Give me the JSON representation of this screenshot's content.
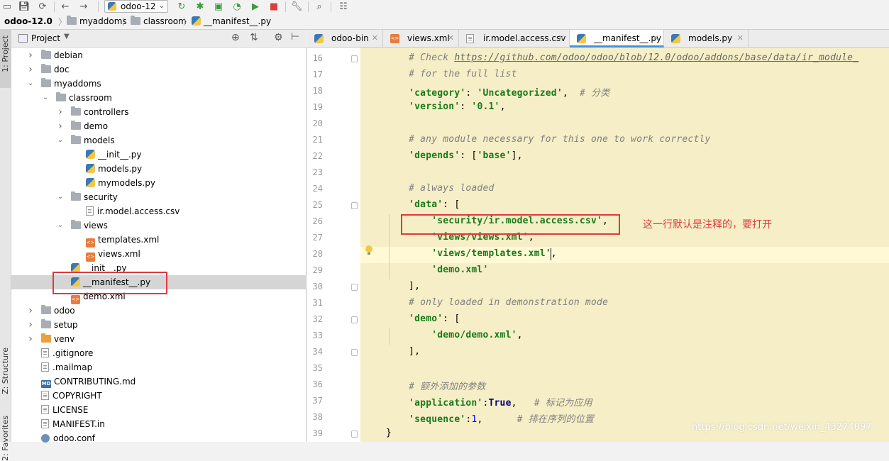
{
  "toolbar": {
    "run_config": "odoo-12",
    "icons": [
      "open-icon",
      "save-icon",
      "sync-icon",
      "back-icon",
      "forward-icon",
      "run-config-icon",
      "rerun-icon",
      "debug-icon",
      "coverage-icon",
      "profile-icon",
      "run-icon",
      "stop-icon",
      "settings-icon",
      "search-icon",
      "structure-icon"
    ]
  },
  "breadcrumb": {
    "items": [
      "odoo-12.0",
      "myaddoms",
      "classroom",
      "__manifest__.py"
    ]
  },
  "left_stripe": {
    "project": "1: Project",
    "structure": "Z: Structure",
    "favorites": "2: Favorites"
  },
  "project_panel": {
    "title": "Project",
    "tree": [
      {
        "label": "debian",
        "type": "folder",
        "depth": 0,
        "expanded": false
      },
      {
        "label": "doc",
        "type": "folder",
        "depth": 0,
        "expanded": false
      },
      {
        "label": "myaddoms",
        "type": "folder",
        "depth": 0,
        "expanded": true
      },
      {
        "label": "classroom",
        "type": "folder",
        "depth": 1,
        "expanded": true
      },
      {
        "label": "controllers",
        "type": "folder",
        "depth": 2,
        "expanded": false
      },
      {
        "label": "demo",
        "type": "folder",
        "depth": 2,
        "expanded": false
      },
      {
        "label": "models",
        "type": "folder",
        "depth": 2,
        "expanded": true
      },
      {
        "label": "__init__.py",
        "type": "py",
        "depth": 3
      },
      {
        "label": "models.py",
        "type": "py",
        "depth": 3
      },
      {
        "label": "mymodels.py",
        "type": "py",
        "depth": 3
      },
      {
        "label": "security",
        "type": "folder",
        "depth": 2,
        "expanded": true
      },
      {
        "label": "ir.model.access.csv",
        "type": "file",
        "depth": 3
      },
      {
        "label": "views",
        "type": "folder",
        "depth": 2,
        "expanded": true
      },
      {
        "label": "templates.xml",
        "type": "xml",
        "depth": 3
      },
      {
        "label": "views.xml",
        "type": "xml",
        "depth": 3
      },
      {
        "label": "__init__.py",
        "type": "py",
        "depth": 2
      },
      {
        "label": "__manifest__.py",
        "type": "py",
        "depth": 2,
        "selected": true
      },
      {
        "label": "demo.xml",
        "type": "xml",
        "depth": 2
      },
      {
        "label": "odoo",
        "type": "folder",
        "depth": 0,
        "expanded": false
      },
      {
        "label": "setup",
        "type": "folder",
        "depth": 0,
        "expanded": false
      },
      {
        "label": "venv",
        "type": "folder-orange",
        "depth": 0,
        "expanded": false
      },
      {
        "label": ".gitignore",
        "type": "file",
        "depth": 0
      },
      {
        "label": ".mailmap",
        "type": "file",
        "depth": 0
      },
      {
        "label": "CONTRIBUTING.md",
        "type": "md",
        "depth": 0
      },
      {
        "label": "COPYRIGHT",
        "type": "file",
        "depth": 0
      },
      {
        "label": "LICENSE",
        "type": "file",
        "depth": 0
      },
      {
        "label": "MANIFEST.in",
        "type": "file",
        "depth": 0
      },
      {
        "label": "odoo.conf",
        "type": "conf",
        "depth": 0
      }
    ]
  },
  "editor_tabs": [
    {
      "label": "odoo-bin",
      "icon": "python-file-icon",
      "active": false
    },
    {
      "label": "views.xml",
      "icon": "xml-file-icon",
      "active": false
    },
    {
      "label": "ir.model.access.csv",
      "icon": "csv-file-icon",
      "active": false
    },
    {
      "label": "__manifest__.py",
      "icon": "python-file-icon",
      "active": true
    },
    {
      "label": "models.py",
      "icon": "python-file-icon",
      "active": false
    }
  ],
  "editor": {
    "lines": [
      {
        "n": "16",
        "parts": [
          [
            "cmt",
            "    # Check "
          ],
          [
            "url",
            "https://github.com/odoo/odoo/blob/12.0/odoo/addons/base/data/ir_module_"
          ]
        ]
      },
      {
        "n": "17",
        "parts": [
          [
            "cmt",
            "    # for the full list"
          ]
        ]
      },
      {
        "n": "18",
        "parts": [
          [
            "txt",
            "    "
          ],
          [
            "str",
            "'category'"
          ],
          [
            "txt",
            ": "
          ],
          [
            "str",
            "'Uncategorized'"
          ],
          [
            "txt",
            ",  "
          ],
          [
            "cmt",
            "# 分类"
          ]
        ]
      },
      {
        "n": "19",
        "parts": [
          [
            "txt",
            "    "
          ],
          [
            "str",
            "'version'"
          ],
          [
            "txt",
            ": "
          ],
          [
            "str",
            "'0.1'"
          ],
          [
            "txt",
            ","
          ]
        ]
      },
      {
        "n": "20",
        "parts": []
      },
      {
        "n": "21",
        "parts": [
          [
            "cmt",
            "    # any module necessary for this one to work correctly"
          ]
        ]
      },
      {
        "n": "22",
        "parts": [
          [
            "txt",
            "    "
          ],
          [
            "str",
            "'depends'"
          ],
          [
            "txt",
            ": ["
          ],
          [
            "str",
            "'base'"
          ],
          [
            "txt",
            "],"
          ]
        ]
      },
      {
        "n": "23",
        "parts": []
      },
      {
        "n": "24",
        "parts": [
          [
            "cmt",
            "    # always loaded"
          ]
        ]
      },
      {
        "n": "25",
        "parts": [
          [
            "txt",
            "    "
          ],
          [
            "str",
            "'data'"
          ],
          [
            "txt",
            ": ["
          ]
        ]
      },
      {
        "n": "26",
        "parts": [
          [
            "txt",
            "        "
          ],
          [
            "str",
            "'security/ir.model.access.csv'"
          ],
          [
            "txt",
            ","
          ]
        ]
      },
      {
        "n": "27",
        "parts": [
          [
            "txt",
            "        "
          ],
          [
            "str",
            "'views/views.xml'"
          ],
          [
            "txt",
            ","
          ]
        ]
      },
      {
        "n": "28",
        "parts": [
          [
            "txt",
            "        "
          ],
          [
            "str",
            "'views/templates.xml'"
          ],
          [
            "txt",
            ","
          ]
        ]
      },
      {
        "n": "29",
        "parts": [
          [
            "txt",
            "        "
          ],
          [
            "str",
            "'demo.xml'"
          ]
        ]
      },
      {
        "n": "30",
        "parts": [
          [
            "txt",
            "    ],"
          ]
        ]
      },
      {
        "n": "31",
        "parts": [
          [
            "cmt",
            "    # only loaded in demonstration mode"
          ]
        ]
      },
      {
        "n": "32",
        "parts": [
          [
            "txt",
            "    "
          ],
          [
            "str",
            "'demo'"
          ],
          [
            "txt",
            ": ["
          ]
        ]
      },
      {
        "n": "33",
        "parts": [
          [
            "txt",
            "        "
          ],
          [
            "str",
            "'demo/demo.xml'"
          ],
          [
            "txt",
            ","
          ]
        ]
      },
      {
        "n": "34",
        "parts": [
          [
            "txt",
            "    ],"
          ]
        ]
      },
      {
        "n": "35",
        "parts": []
      },
      {
        "n": "36",
        "parts": [
          [
            "cmt",
            "    # 额外添加的参数"
          ]
        ]
      },
      {
        "n": "37",
        "parts": [
          [
            "txt",
            "    "
          ],
          [
            "str",
            "'application'"
          ],
          [
            "txt",
            ":"
          ],
          [
            "kw",
            "True"
          ],
          [
            "txt",
            ",   "
          ],
          [
            "cmt",
            "# 标记为应用"
          ]
        ]
      },
      {
        "n": "38",
        "parts": [
          [
            "txt",
            "    "
          ],
          [
            "str",
            "'sequence'"
          ],
          [
            "txt",
            ":"
          ],
          [
            "num",
            "1"
          ],
          [
            "txt",
            ",      "
          ],
          [
            "cmt",
            "# 排在序列的位置"
          ]
        ]
      },
      {
        "n": "39",
        "parts": [
          [
            "txt",
            "}"
          ]
        ]
      }
    ]
  },
  "annotation": "这一行默认是注释的，要打开",
  "watermark": "https://blog.csdn.net/weixin_43274097",
  "colors": {
    "highlight_box": "#e0393e",
    "editor_bg": "#f5eec6",
    "accent": "#4a90d9"
  }
}
